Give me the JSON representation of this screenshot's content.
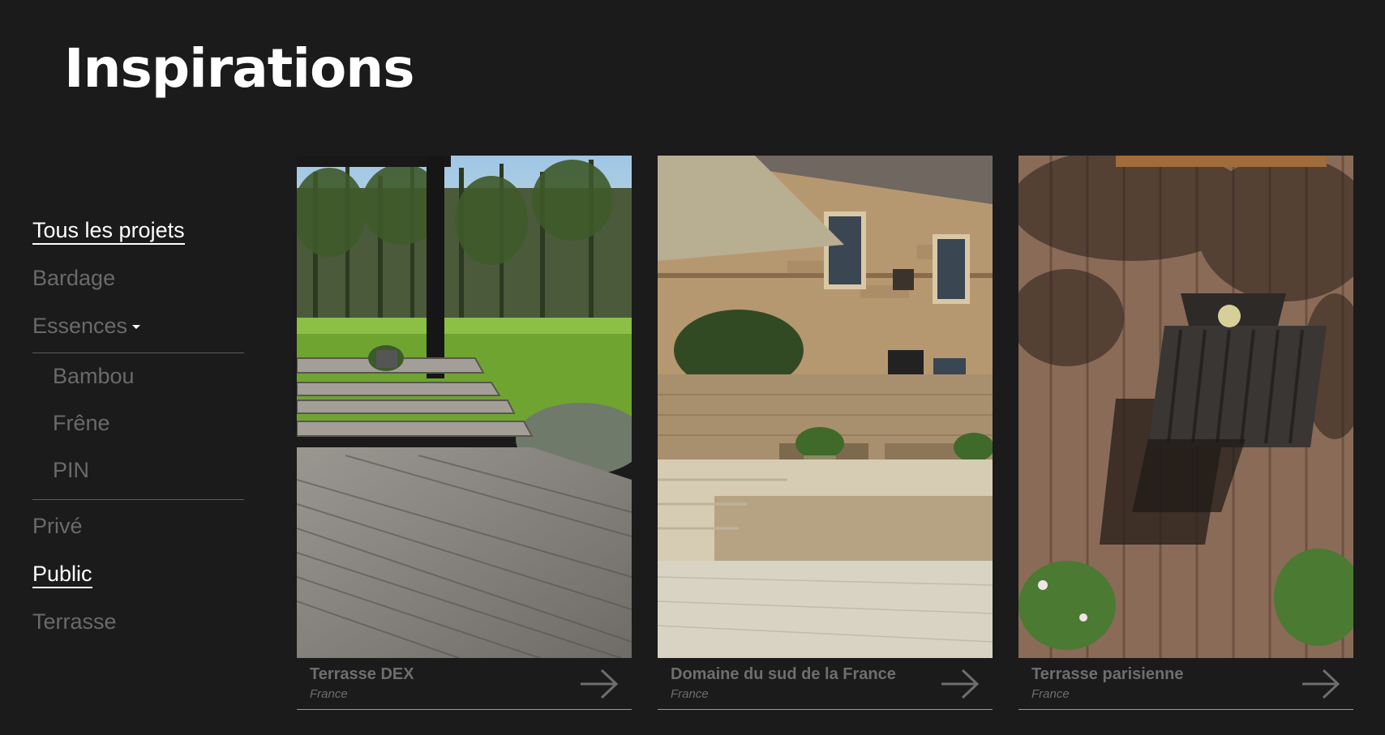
{
  "page": {
    "title": "Inspirations"
  },
  "sidebar": {
    "items": [
      {
        "label": "Tous les projets",
        "active": true
      },
      {
        "label": "Bardage",
        "active": false
      },
      {
        "label": "Essences",
        "active": false
      },
      {
        "label": "Privé",
        "active": false
      },
      {
        "label": "Public",
        "active": true
      },
      {
        "label": "Terrasse",
        "active": false
      }
    ],
    "submenu": [
      {
        "label": "Bambou"
      },
      {
        "label": "Frêne"
      },
      {
        "label": "PIN"
      }
    ]
  },
  "projects": [
    {
      "title": "Terrasse DEX",
      "location": "France"
    },
    {
      "title": "Domaine du sud de la France",
      "location": "France"
    },
    {
      "title": "Terrasse parisienne",
      "location": "France"
    }
  ],
  "colors": {
    "background": "#1b1b1b",
    "active": "#ffffff",
    "inactive": "#6a6a6a"
  }
}
